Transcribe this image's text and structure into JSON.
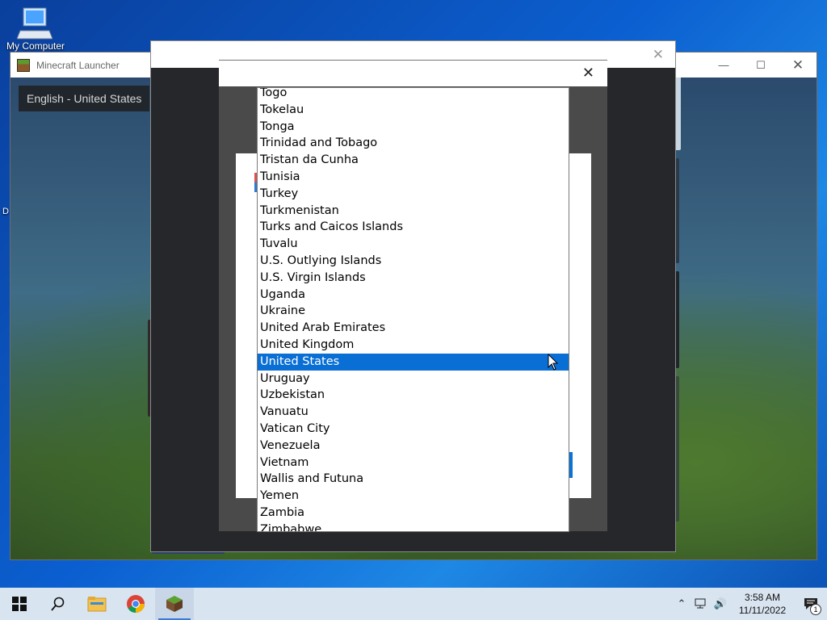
{
  "desktop": {
    "icon_label": "My Computer",
    "side_label": "D"
  },
  "mc_window": {
    "title": "Minecraft Launcher",
    "language_button": "English - United States"
  },
  "dropdown": {
    "items": [
      "Togo",
      "Tokelau",
      "Tonga",
      "Trinidad and Tobago",
      "Tristan da Cunha",
      "Tunisia",
      "Turkey",
      "Turkmenistan",
      "Turks and Caicos Islands",
      "Tuvalu",
      "U.S. Outlying Islands",
      "U.S. Virgin Islands",
      "Uganda",
      "Ukraine",
      "United Arab Emirates",
      "United Kingdom",
      "United States",
      "Uruguay",
      "Uzbekistan",
      "Vanuatu",
      "Vatican City",
      "Venezuela",
      "Vietnam",
      "Wallis and Futuna",
      "Yemen",
      "Zambia",
      "Zimbabwe"
    ],
    "selected": "United States"
  },
  "taskbar": {
    "time": "3:58 AM",
    "date": "11/11/2022",
    "notification_count": "1"
  },
  "colors": {
    "selection": "#0a6fd4",
    "accent_button": "#0a73d6"
  }
}
